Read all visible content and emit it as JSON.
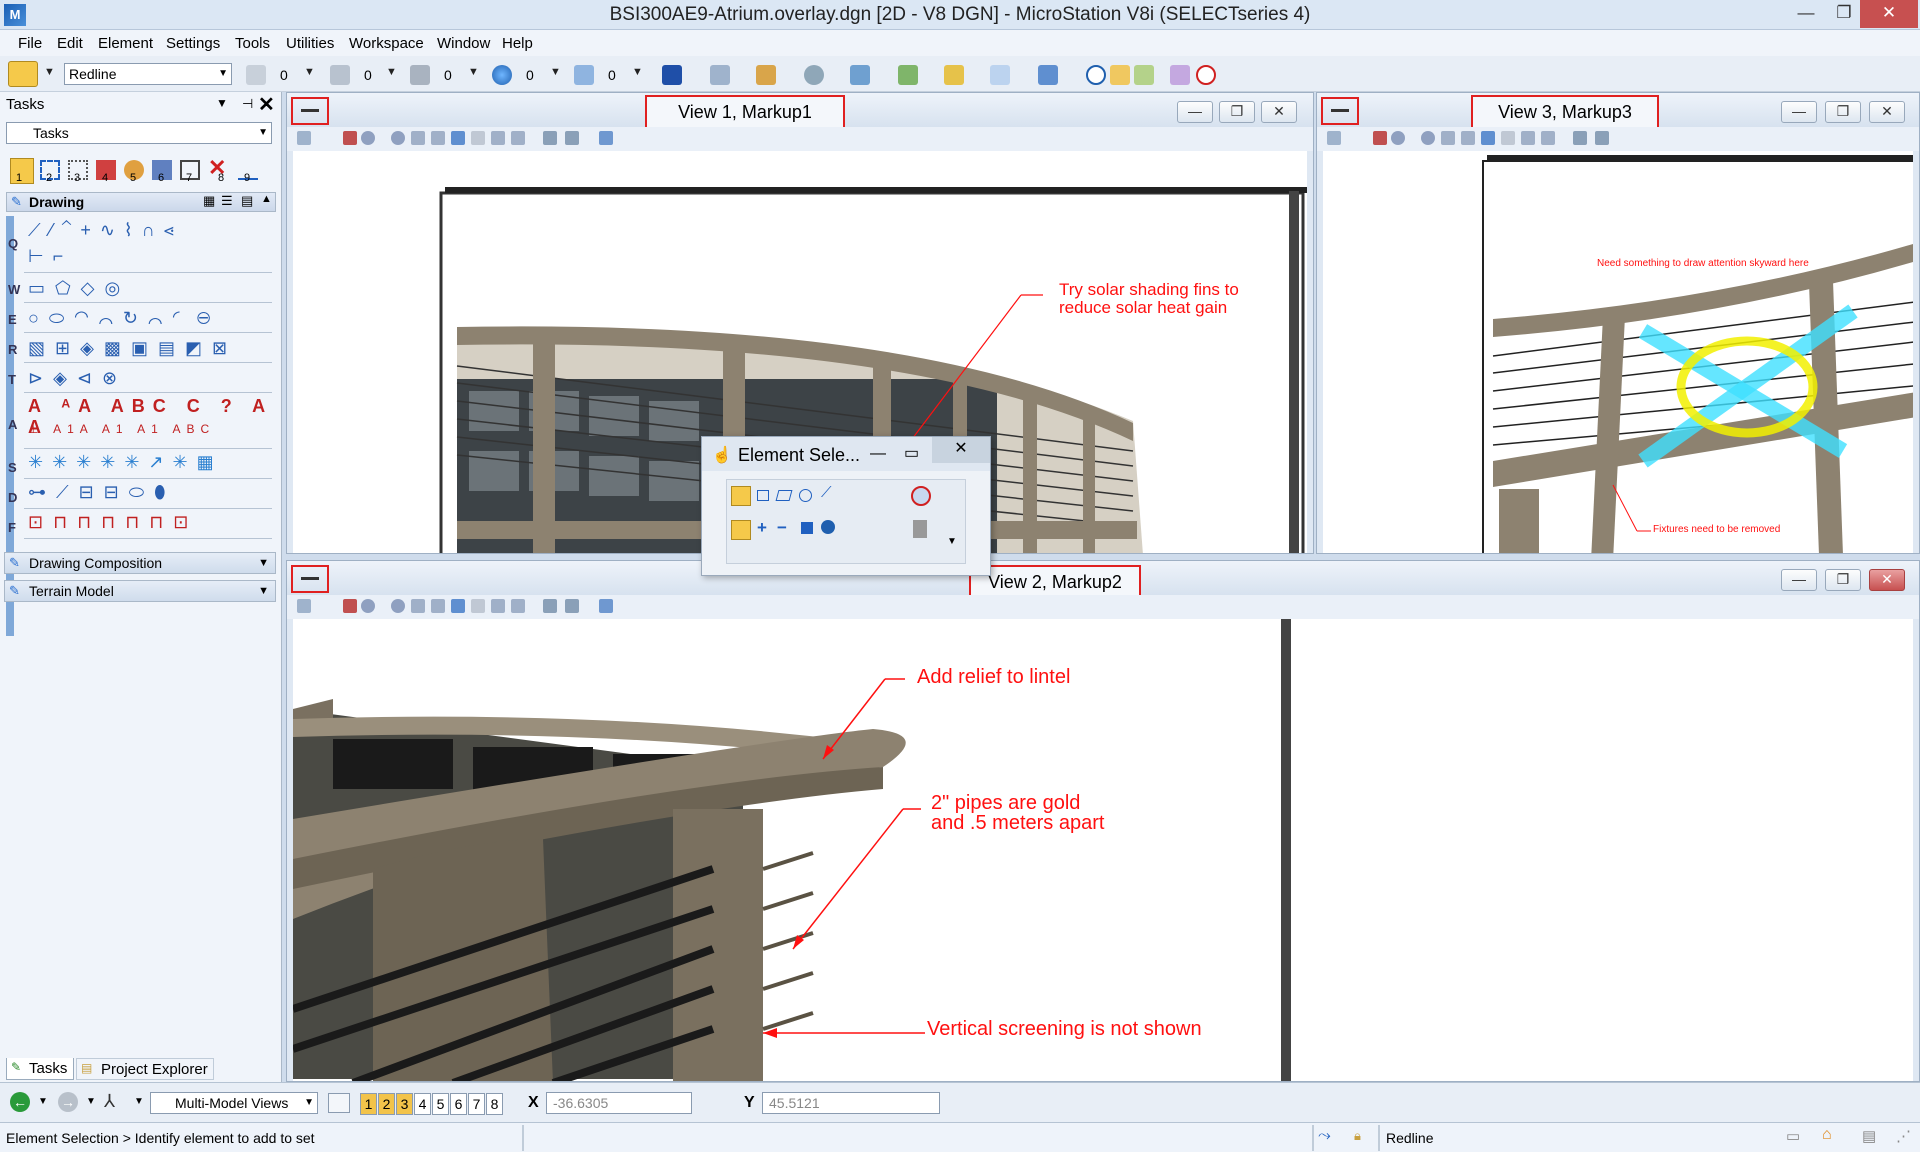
{
  "window": {
    "title": "BSI300AE9-Atrium.overlay.dgn [2D - V8 DGN] - MicroStation V8i (SELECTseries 4)",
    "app_icon": "M",
    "minimize": "—",
    "maximize": "❐",
    "close": "✕"
  },
  "menu": [
    "File",
    "Edit",
    "Element",
    "Settings",
    "Tools",
    "Utilities",
    "Workspace",
    "Window",
    "Help"
  ],
  "toolbar": {
    "level_combo": "Redline",
    "values": [
      "0",
      "0",
      "0",
      "0",
      "0"
    ]
  },
  "tasks": {
    "title": "Tasks",
    "combo": "Tasks",
    "tool_numbers": [
      "1",
      "2",
      "3",
      "4",
      "5",
      "6",
      "7",
      "8",
      "9"
    ],
    "drawing_group": "Drawing",
    "row_letters": [
      "Q",
      "W",
      "E",
      "R",
      "T",
      "A",
      "S",
      "D",
      "F"
    ],
    "groups": [
      "Drawing Composition",
      "Terrain Model"
    ],
    "tabs": [
      "Tasks",
      "Project Explorer"
    ]
  },
  "views": {
    "view1": {
      "title": "View 1, Markup1",
      "note": "Try solar shading fins to\nreduce solar heat gain"
    },
    "view3": {
      "title": "View 3, Markup3",
      "note_top": "Need something to draw attention skyward here",
      "note_bottom": "Fixtures need to be removed"
    },
    "view2": {
      "title": "View 2, Markup2",
      "note1": "Add relief to lintel",
      "note2": "2\" pipes are gold\nand .5 meters apart",
      "note3": "Vertical screening is not shown"
    }
  },
  "element_selection": {
    "title": "Element Sele...",
    "minimize": "—",
    "maximize": "▭",
    "close": "✕"
  },
  "bottom": {
    "model_combo": "Multi-Model Views",
    "view_numbers": [
      "1",
      "2",
      "3",
      "4",
      "5",
      "6",
      "7",
      "8"
    ],
    "active_views": [
      1,
      3
    ],
    "x_label": "X",
    "x_value": "-36.6305",
    "y_label": "Y",
    "y_value": "45.5121"
  },
  "status": {
    "prompt": "Element Selection > Identify element to add to set",
    "level": "Redline"
  },
  "colors": {
    "annotation": "#ff1010",
    "highlight": "#e02020"
  }
}
